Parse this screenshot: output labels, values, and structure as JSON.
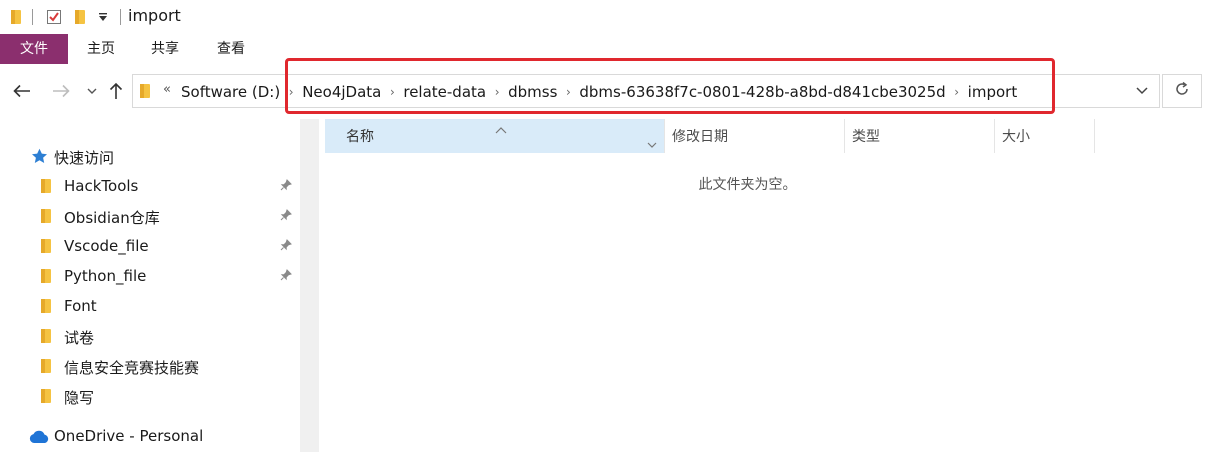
{
  "window": {
    "title": "import"
  },
  "quick_access_toolbar": {
    "icons": [
      "folder-icon",
      "properties-check-icon",
      "new-folder-icon",
      "customize-dropdown-icon"
    ]
  },
  "ribbon": {
    "tabs": [
      {
        "label": "文件",
        "active": true
      },
      {
        "label": "主页"
      },
      {
        "label": "共享"
      },
      {
        "label": "查看"
      }
    ],
    "file_tab_color": "#8b2f6e"
  },
  "address_bar": {
    "lead": "«",
    "crumbs": [
      "Software (D:)",
      "Neo4jData",
      "relate-data",
      "dbmss",
      "dbms-63638f7c-0801-428b-a8bd-d841cbe3025d",
      "import"
    ],
    "highlight_color": "#e0282e"
  },
  "nav_pane": {
    "quick_access": "快速访问",
    "items": [
      {
        "label": "HackTools",
        "pinned": true
      },
      {
        "label": "Obsidian仓库",
        "pinned": true
      },
      {
        "label": "Vscode_file",
        "pinned": true
      },
      {
        "label": "Python_file",
        "pinned": true
      },
      {
        "label": "Font",
        "pinned": false
      },
      {
        "label": "试卷",
        "pinned": false
      },
      {
        "label": "信息安全竞赛技能赛",
        "pinned": false
      },
      {
        "label": "隐写",
        "pinned": false
      }
    ],
    "onedrive": "OneDrive - Personal"
  },
  "file_list": {
    "columns": [
      "名称",
      "修改日期",
      "类型",
      "大小"
    ],
    "empty_message": "此文件夹为空。"
  },
  "colors": {
    "selected_column_header": "#d9ebf9",
    "folder_yellow": "#f5c342",
    "star_blue": "#2d7fd3",
    "onedrive_blue": "#1f74d6"
  }
}
